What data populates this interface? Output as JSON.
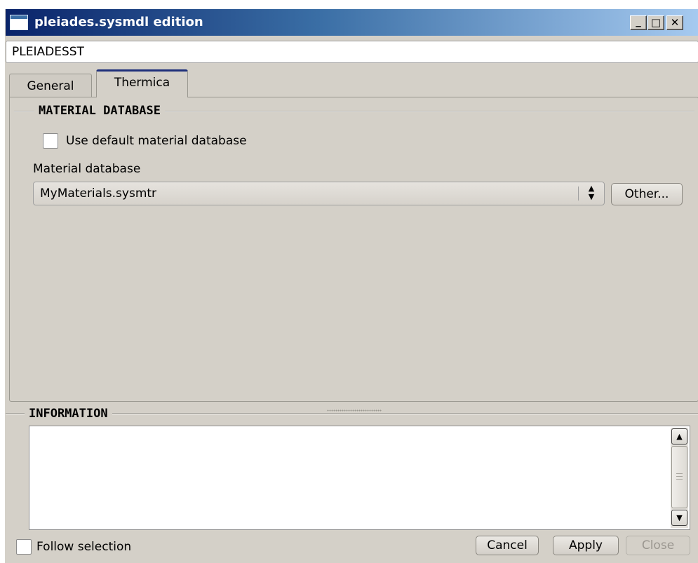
{
  "window": {
    "title": "pleiades.sysmdl edition",
    "controls": {
      "minimize": "_",
      "maximize": "□",
      "close": "✕"
    }
  },
  "name_field": {
    "value": "PLEIADESST"
  },
  "tabs": [
    {
      "label": "General",
      "active": false
    },
    {
      "label": "Thermica",
      "active": true
    }
  ],
  "material_database_group": {
    "title": "MATERIAL DATABASE",
    "use_default_checkbox": {
      "label": "Use default material database",
      "checked": false
    },
    "material_database_label": "Material database",
    "material_database_select": {
      "value": "MyMaterials.sysmtr",
      "arrows": "▲▼"
    },
    "other_button": "Other..."
  },
  "information_group": {
    "title": "INFORMATION",
    "text": "",
    "scroll_up": "▲",
    "scroll_down": "▼"
  },
  "footer": {
    "follow_selection": {
      "label": "Follow selection",
      "checked": false
    },
    "cancel": "Cancel",
    "apply": "Apply",
    "close": "Close",
    "close_enabled": false
  },
  "colors": {
    "titlebar_start": "#0a246a",
    "titlebar_end": "#a6caf0",
    "active_tab_accent": "#1e2f7a",
    "window_bg": "#d4d0c8"
  },
  "icons": [
    "window-icon",
    "minimize-icon",
    "maximize-icon",
    "close-icon",
    "spinner-arrows-icon",
    "scroll-up-icon",
    "scroll-down-icon"
  ]
}
